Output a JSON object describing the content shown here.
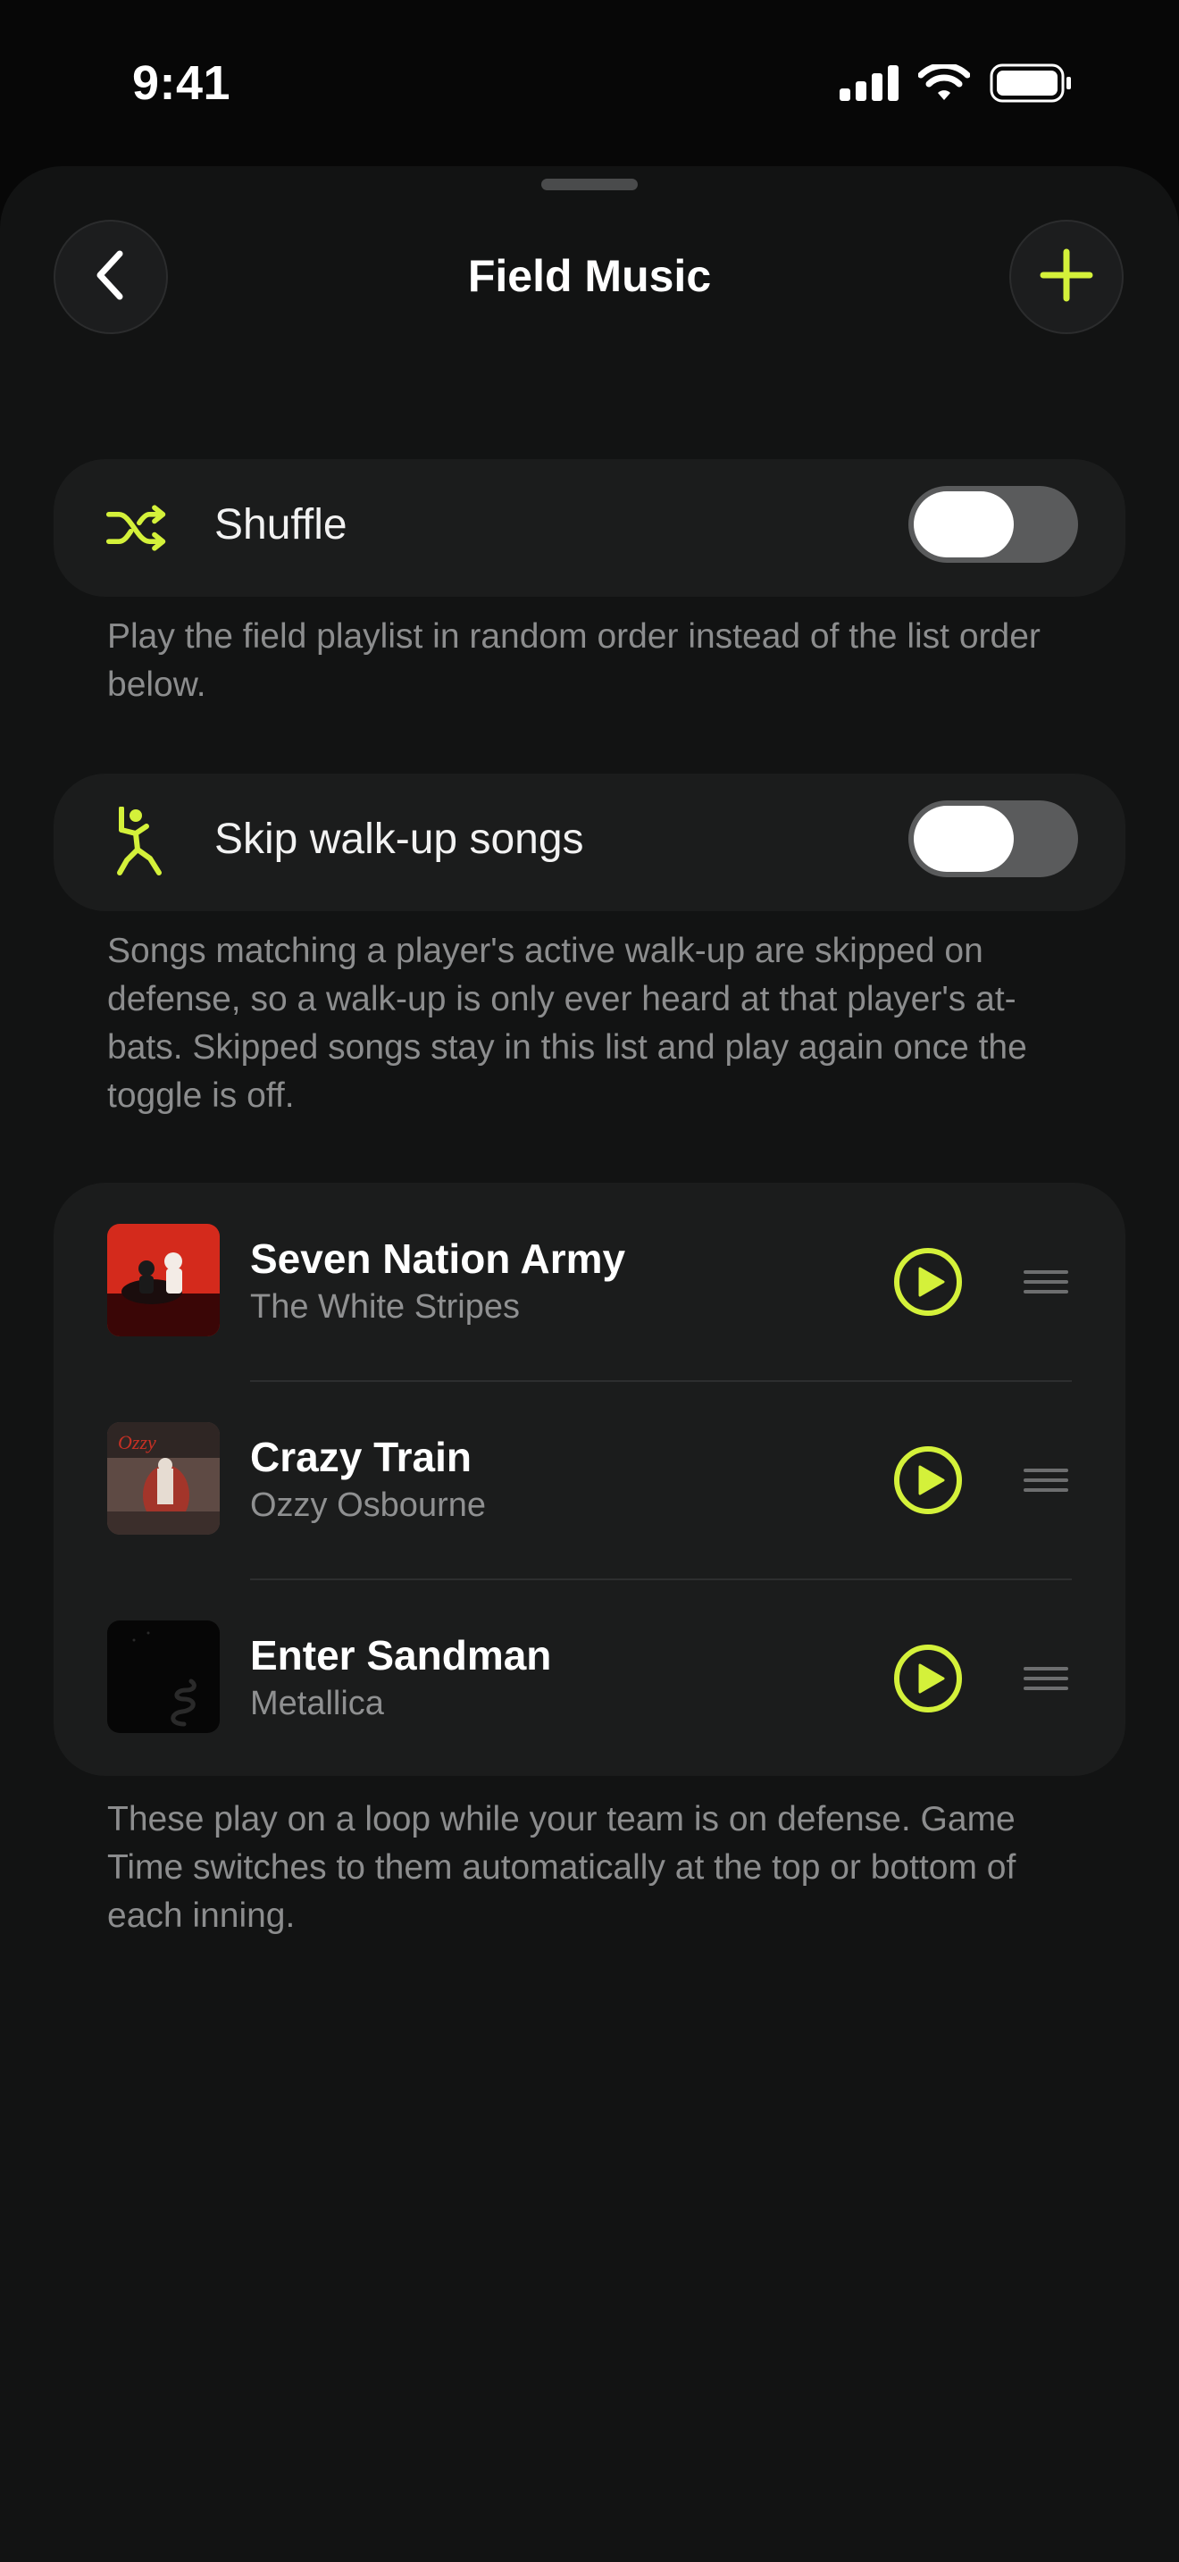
{
  "status_bar": {
    "time": "9:41"
  },
  "header": {
    "title": "Field Music"
  },
  "shuffle": {
    "label": "Shuffle",
    "enabled": false,
    "description": "Play the field playlist in random order instead of the list order below."
  },
  "skip_walkup": {
    "label": "Skip walk-up songs",
    "enabled": false,
    "description": "Songs matching a player's active walk-up are skipped on defense, so a walk-up is only ever heard at that player's at-bats. Skipped songs stay in this list and play again once the toggle is off."
  },
  "songs": [
    {
      "title": "Seven Nation Army",
      "artist": "The White Stripes"
    },
    {
      "title": "Crazy Train",
      "artist": "Ozzy Osbourne"
    },
    {
      "title": "Enter Sandman",
      "artist": "Metallica"
    }
  ],
  "footer": {
    "note": "These play on a loop while your team is on defense. Game Time switches to them automatically at the top or bottom of each inning."
  },
  "colors": {
    "accent": "#d4f13a",
    "background": "#070707",
    "card": "#1b1c1c"
  },
  "icons": [
    "signal-icon",
    "wifi-icon",
    "battery-icon",
    "back-icon",
    "plus-icon",
    "shuffle-icon",
    "batter-icon",
    "play-icon",
    "drag-handle-icon"
  ]
}
